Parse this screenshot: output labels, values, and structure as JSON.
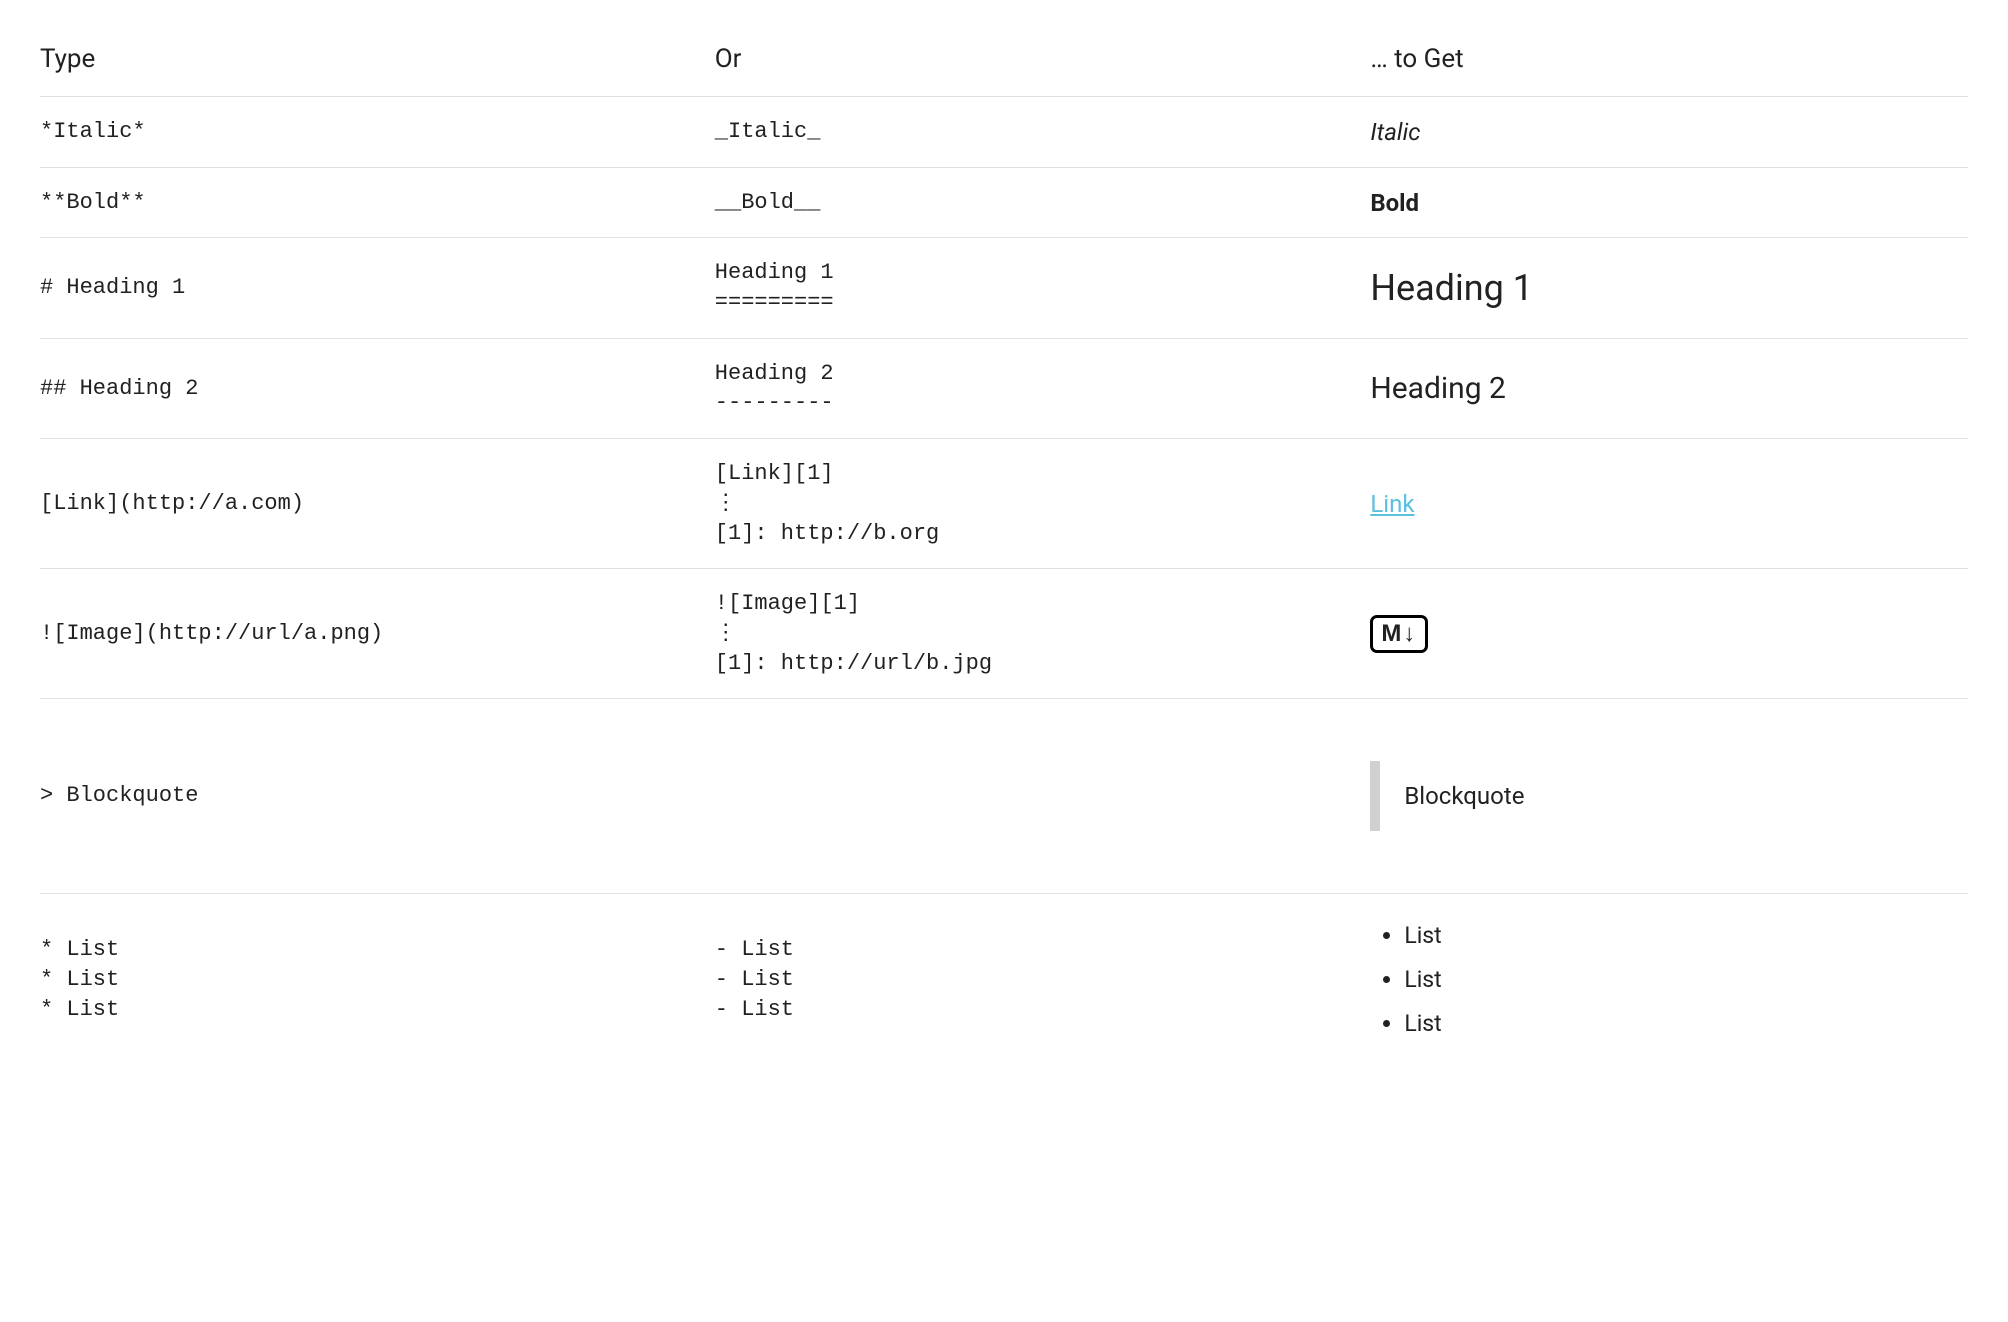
{
  "headers": {
    "type": "Type",
    "or": "Or",
    "to_get": "… to Get"
  },
  "rows": {
    "italic": {
      "type": "*Italic*",
      "or": "_Italic_",
      "result": "Italic"
    },
    "bold": {
      "type": "**Bold**",
      "or": "__Bold__",
      "result": "Bold"
    },
    "h1": {
      "type": "# Heading 1",
      "or": "Heading 1\n=========",
      "result": "Heading 1"
    },
    "h2": {
      "type": "## Heading 2",
      "or": "Heading 2\n---------",
      "result": "Heading 2"
    },
    "link": {
      "type": "[Link](http://a.com)",
      "or": "[Link][1]\n⋮\n[1]: http://b.org",
      "result": "Link"
    },
    "image": {
      "type": "![Image](http://url/a.png)",
      "or": "![Image][1]\n⋮\n[1]: http://url/b.jpg",
      "result_badge": "M↓"
    },
    "blockquote": {
      "type": "> Blockquote",
      "result": "Blockquote"
    },
    "list": {
      "type": "* List\n* List\n* List",
      "or": "- List\n- List\n- List",
      "items": [
        "List",
        "List",
        "List"
      ]
    }
  }
}
